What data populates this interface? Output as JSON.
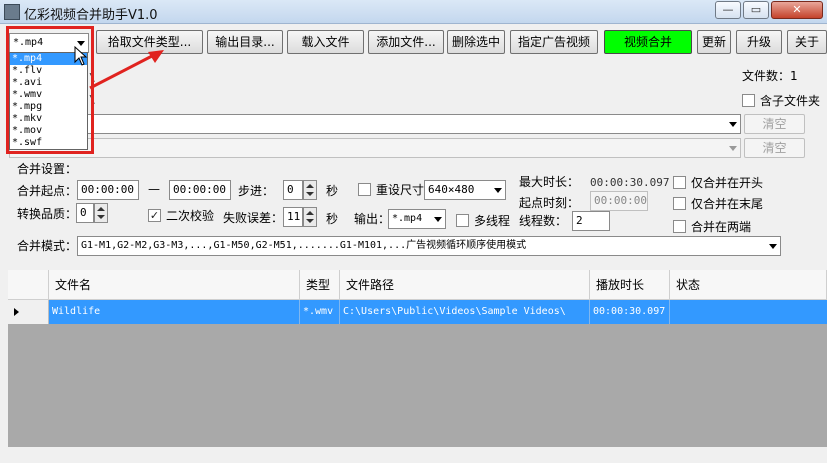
{
  "window": {
    "title": "亿彩视频合并助手V1.0",
    "min_label": "—",
    "max_label": "▭",
    "close_label": "✕"
  },
  "toolbar": {
    "format_value": "*.mp4",
    "pick_types": "拾取文件类型...",
    "output_dir": "输出目录...",
    "load_file": "载入文件",
    "add_file": "添加文件...",
    "delete_selected": "删除选中",
    "set_ad_video": "指定广告视频",
    "merge_video": "视频合并",
    "update": "更新",
    "upgrade": "升级",
    "about": "关于"
  },
  "format_dropdown": {
    "options": [
      "*.mp4",
      "*.flv",
      "*.avi",
      "*.wmv",
      "*.mpg",
      "*.mkv",
      "*.mov",
      "*.swf"
    ],
    "selected_index": 0
  },
  "behind_list": {
    "fragment_1": "\\",
    "fragment_2": "\\"
  },
  "right_info": {
    "file_count_label": "文件数：1",
    "include_subfolders": "含子文件夹"
  },
  "rows": {
    "clear_1": "清空",
    "clear_2": "清空"
  },
  "merge_settings": {
    "section_label": "合并设置：",
    "start_label": "合并起点：",
    "start_value": "00:00:00",
    "dash": "—",
    "end_value": "00:00:00",
    "step_label": "步进：",
    "step_value": "0",
    "seconds_1": "秒",
    "resize_label": "重设尺寸",
    "resize_value": "640×480",
    "max_duration_label": "最大时长：",
    "max_duration_value": "00:00:30.097",
    "only_start_label": "仅合并在开头",
    "quality_label": "转换品质：",
    "quality_value": "0",
    "second_check_label": "二次校验",
    "fail_error_label": "失败误差：",
    "fail_error_value": "11",
    "seconds_2": "秒",
    "output_label": "输出：",
    "output_value": "*.mp4",
    "multithread_label": "多线程",
    "thread_count_label": "线程数：",
    "thread_count_value": "2",
    "start_time_label": "起点时刻：",
    "start_time_value": "00:00:00",
    "only_end_label": "仅合并在末尾",
    "both_ends_label": "合并在两端",
    "mode_label": "合并模式：",
    "mode_value": "G1-M1,G2-M2,G3-M3,...,G1-M50,G2-M51,.......G1-M101,...广告视频循环顺序使用模式"
  },
  "checkboxes": {
    "include_subfolders": false,
    "resize": false,
    "second_check": true,
    "multithread": false,
    "only_start": false,
    "only_end": false,
    "both_ends": false
  },
  "file_table": {
    "columns": [
      "文件名",
      "类型",
      "文件路径",
      "播放时长",
      "状态"
    ],
    "rows": [
      {
        "name": "Wildlife",
        "type": "*.wmv",
        "path": "C:\\Users\\Public\\Videos\\Sample Videos\\",
        "duration": "00:00:30.097",
        "status": ""
      }
    ]
  },
  "colors": {
    "merge_button": "#00ff00",
    "selection": "#3399ff",
    "highlight_box": "#e0231f"
  }
}
